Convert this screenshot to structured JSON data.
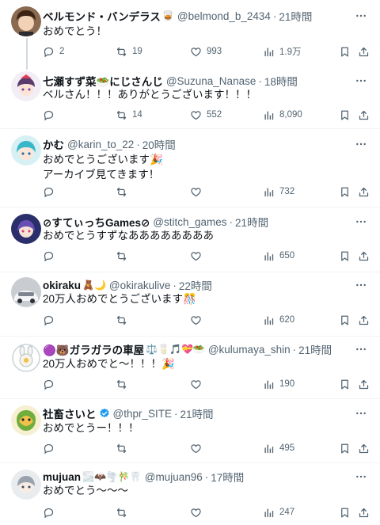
{
  "tweets": [
    {
      "name": "ベルモンド・バンデラス",
      "emoji": "🥃",
      "handle": "@belmond_b_2434",
      "time": "21時間",
      "text": "おめでとう！",
      "replies": "2",
      "retweets": "19",
      "likes": "993",
      "views": "1.9万"
    },
    {
      "name": "七瀬すず菜🥗にじさんじ",
      "emoji": "",
      "handle": "@Suzuna_Nanase",
      "time": "18時間",
      "text": "ベルさん！！！ありがとうございます！！！",
      "replies": "",
      "retweets": "14",
      "likes": "552",
      "views": "8,090"
    },
    {
      "name": "かむ",
      "emoji": "",
      "handle": "@karin_to_22",
      "time": "20時間",
      "text": "おめでとうございます🎉\nアーカイブ見てきます！",
      "replies": "",
      "retweets": "",
      "likes": "",
      "views": "732"
    },
    {
      "name": "⊘すてぃっちGames⊘",
      "emoji": "",
      "handle": "@stitch_games",
      "time": "21時間",
      "text": "おめでとうすずなああああああああ",
      "replies": "",
      "retweets": "",
      "likes": "",
      "views": "650"
    },
    {
      "name": "okiraku",
      "emoji": "🧸🌙",
      "handle": "@okirakulive",
      "time": "22時間",
      "text": "20万人おめでとうございます🎊",
      "replies": "",
      "retweets": "",
      "likes": "",
      "views": "620"
    },
    {
      "name": "🟣🐻ガラガラの車屋",
      "emoji": "⚖️🥛🎵💝🥗",
      "handle": "@kulumaya_shin",
      "time": "21時間",
      "text": "20万人おめでと〜！！！🎉",
      "replies": "",
      "retweets": "",
      "likes": "",
      "views": "190"
    },
    {
      "name": "社畜さいと",
      "emoji": "",
      "handle": "@thpr_SITE",
      "time": "21時間",
      "text": "おめでとうー！！！",
      "replies": "",
      "retweets": "",
      "likes": "",
      "views": "495"
    },
    {
      "name": "mujuan",
      "emoji": "🌫️🦇🌪️🎋🦷",
      "handle": "@mujuan96",
      "time": "17時間",
      "text": "おめでとう〜〜〜",
      "replies": "",
      "retweets": "",
      "likes": "",
      "views": "247"
    }
  ],
  "ui": {
    "dot": "·",
    "accent": "#1d9bf0",
    "icons": [
      "reply-icon",
      "retweet-icon",
      "like-icon",
      "views-icon",
      "bookmark-icon",
      "share-icon",
      "more-icon",
      "verified-icon"
    ]
  }
}
